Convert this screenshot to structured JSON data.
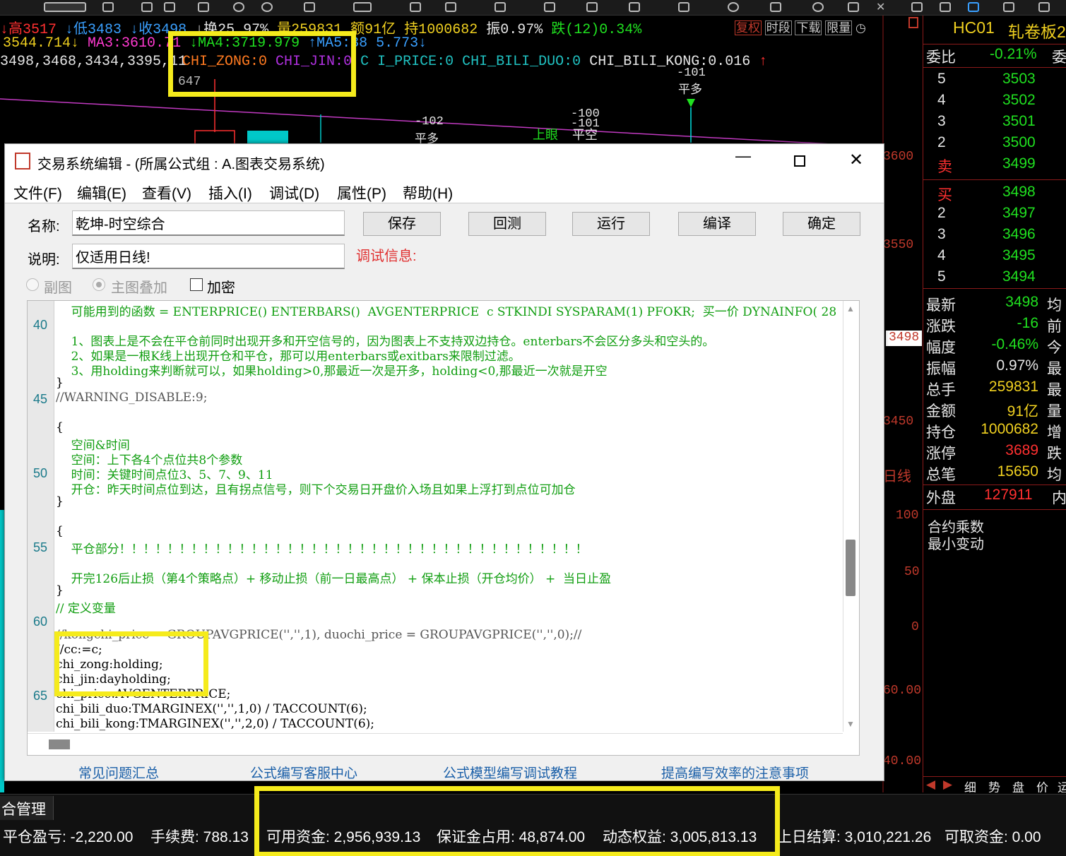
{
  "chart": {
    "top_line1": [
      "↓高3517",
      "↓低3483",
      "↓收3498",
      "↓换25.97%",
      "量259831",
      "额91亿",
      "持1000682",
      "振0.97%",
      "跌(12)0.34%"
    ],
    "top_line2": [
      "3544.714↓",
      "MA3:3610.71",
      "↓MA4:3719.979",
      "↑MA5:38",
      "5.773↓"
    ],
    "top_line3_left": "3498,3468,3434,3395,11",
    "ind_zong": "CHI_ZONG:0",
    "ind_jin": "CHI_JIN:0",
    "ind_price": "C   I_PRICE:0",
    "ind_duo": "CHI_BILI_DUO:0",
    "ind_kong": "CHI_BILI_KONG:0.016",
    "ind_arrow": "↑",
    "label_647": "647",
    "buttons": [
      "复权",
      "时段",
      "下载",
      "限量"
    ],
    "sig_101": "-101",
    "sig_pingduo1": "平多",
    "sig_102": "-102",
    "sig_pingduo2": "平多",
    "sig_100": "-100",
    "sig_101b": "-101",
    "sig_shangyan": "上眼",
    "sig_pingkong": "平空",
    "y_labels": [
      "3600",
      "3550",
      "3450",
      "日线",
      "100",
      "50",
      "0",
      "60.00",
      "40.00"
    ],
    "price_tag": "3498"
  },
  "quote": {
    "symbol": "HC01",
    "name": "轧卷板2",
    "weibi_label": "委比",
    "weibi_value": "-0.21%",
    "weicha": "委",
    "sell_levels": [
      {
        "lv": "5",
        "p": "3503"
      },
      {
        "lv": "4",
        "p": "3502"
      },
      {
        "lv": "3",
        "p": "3501"
      },
      {
        "lv": "2",
        "p": "3500"
      },
      {
        "lv": "卖",
        "p": "3499"
      }
    ],
    "buy_levels": [
      {
        "lv": "买",
        "p": "3498"
      },
      {
        "lv": "2",
        "p": "3497"
      },
      {
        "lv": "3",
        "p": "3496"
      },
      {
        "lv": "4",
        "p": "3495"
      },
      {
        "lv": "5",
        "p": "3494"
      }
    ],
    "stats": [
      {
        "k": "最新",
        "v": "3498",
        "r": "均"
      },
      {
        "k": "涨跌",
        "v": "-16",
        "r": "前"
      },
      {
        "k": "幅度",
        "v": "-0.46%",
        "r": "今"
      },
      {
        "k": "振幅",
        "v": "0.97%",
        "r": "最"
      },
      {
        "k": "总手",
        "v": "259831",
        "r": "最"
      },
      {
        "k": "金额",
        "v": "91亿",
        "r": "量"
      },
      {
        "k": "持仓",
        "v": "1000682",
        "r": "增"
      },
      {
        "k": "涨停",
        "v": "3689",
        "r": "跌"
      },
      {
        "k": "总笔",
        "v": "15650",
        "r": "均"
      }
    ],
    "waipan_label": "外盘",
    "waipan_value": "127911",
    "neipan": "内",
    "extra1": "合约乘数",
    "extra2": "最小变动",
    "bottom_tabs": [
      "细",
      "势",
      "盘",
      "价",
      "运"
    ]
  },
  "dialog": {
    "title": "交易系统编辑 - (所属公式组 : A.图表交易系统)",
    "menu": [
      "文件(F)",
      "编辑(E)",
      "查看(V)",
      "插入(I)",
      "调试(D)",
      "属性(P)",
      "帮助(H)"
    ],
    "name_label": "名称:",
    "name_value": "乾坤-时空综合",
    "desc_label": "说明:",
    "desc_value": "仅适用日线!",
    "buttons": [
      "保存",
      "回测",
      "运行",
      "编译",
      "确定"
    ],
    "debug_label": "调试信息:",
    "radio_sub": "副图",
    "radio_main": "主图叠加",
    "checkbox_encrypt": "加密",
    "line_numbers": [
      "40",
      "45",
      "50",
      "55",
      "60",
      "65"
    ],
    "code": [
      "    可能用到的函数 = ENTERPRICE() ENTERBARS()  AVGENTERPRICE  c STKINDI SYSPARAM(1) PFOKR;  买一价 DYNAINFO( 28",
      "",
      "    1、图表上是不会在平仓前同时出现开多和开空信号的，因为图表上不支持双边持仓。enterbars不会区分多头和空头的。",
      "    2、如果是一根K线上出现开仓和平仓，那可以用enterbars或exitbars来限制过滤。",
      "    3、用holding来判断就可以，如果holding>0,那最近一次是开多，holding<0,那最近一次就是开空",
      "}",
      "//WARNING_DISABLE:9;",
      "",
      "{",
      "    空间&时间",
      "    空间：上下各4个点位共8个参数",
      "    时间：关键时间点位3、5、7、9、11",
      "    开仓：昨天时间点位到达，且有拐点信号，则下个交易日开盘价入场且如果上浮打到点位可加仓",
      "}",
      "",
      "{",
      "    平仓部分！！！！！！！！！！！！！！！！！！！！！！！！！！！！！！！！！！！！！！！",
      "",
      "    开完126后止损（第4个策略点）+ 移动止损（前一日最高点） + 保本止损（开仓均价） +  当日止盈",
      "}",
      "// 定义变量",
      "",
      "//kongchi_price = GROUPAVGPRICE('','',1), duochi_price = GROUPAVGPRICE('','',0);//",
      "//cc:=c;",
      "chi_zong:holding;",
      "chi_jin:dayholding;",
      "chi_price:AVGENTERPRICE;",
      "chi_bili_duo:TMARGINEX('','',1,0) / TACCOUNT(6);",
      "chi_bili_kong:TMARGINEX('','',2,0) / TACCOUNT(6);"
    ],
    "links": [
      "常见问题汇总",
      "公式编写客服中心",
      "公式模型编写调试教程",
      "提高编写效率的注意事项"
    ]
  },
  "status": {
    "tab": "合管理",
    "items": [
      "平仓盈亏: -2,220.00",
      "手续费: 788.13",
      "可用资金: 2,956,939.13",
      "保证金占用: 48,874.00",
      "动态权益: 3,005,813.13",
      "上日结算: 3,010,221.26",
      "可取资金: 0.00"
    ]
  }
}
